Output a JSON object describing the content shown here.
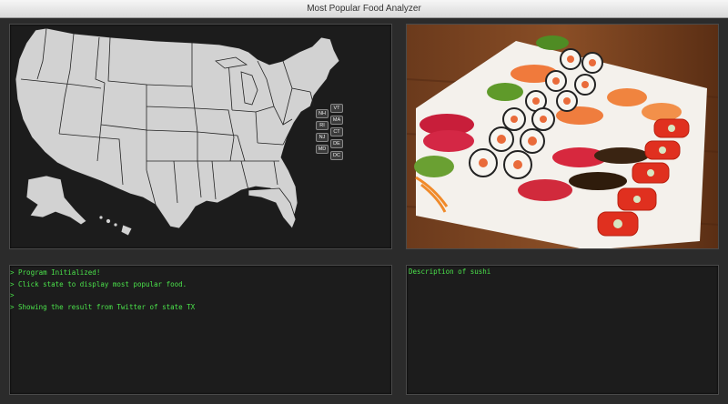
{
  "window": {
    "title": "Most Popular Food Analyzer"
  },
  "map": {
    "small_states": [
      "VT",
      "NH",
      "MA",
      "RI",
      "CT",
      "NJ",
      "DE",
      "MD",
      "DC"
    ]
  },
  "photo": {
    "subject": "sushi-platter-image"
  },
  "console": {
    "lines": [
      "> Program Initialized!",
      "> Click state to display most popular food.",
      ">",
      "> Showing the result from Twitter of state TX"
    ]
  },
  "description": {
    "text": "Description of sushi"
  },
  "colors": {
    "console_text": "#4be34b",
    "panel_bg": "#1c1c1c",
    "window_bg": "#2b2b2b",
    "state_fill": "#d2d2d2"
  }
}
